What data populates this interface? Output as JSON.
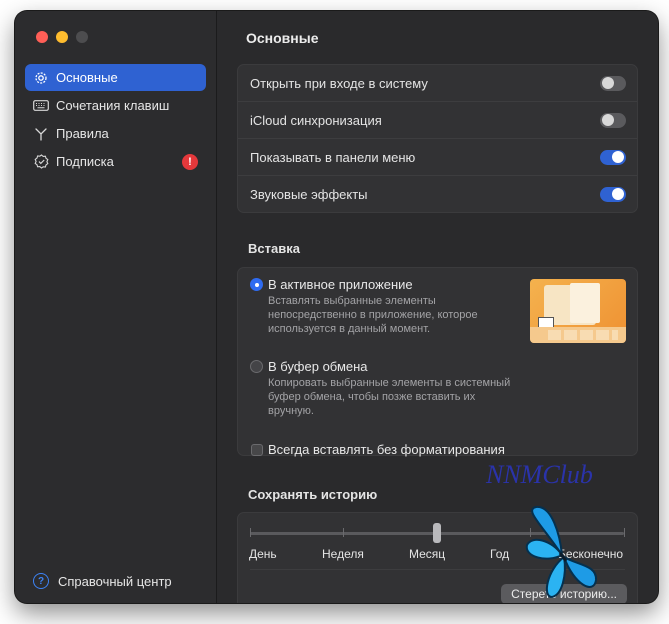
{
  "sidebar": {
    "items": [
      {
        "label": "Основные",
        "icon": "gear-icon",
        "active": true
      },
      {
        "label": "Сочетания клавиш",
        "icon": "keyboard-icon",
        "active": false
      },
      {
        "label": "Правила",
        "icon": "branch-icon",
        "active": false
      },
      {
        "label": "Подписка",
        "icon": "checkmark-seal-icon",
        "active": false,
        "badge": "!"
      }
    ],
    "help": {
      "label": "Справочный центр",
      "icon": "question-circle-icon"
    }
  },
  "main": {
    "title": "Основные",
    "general": {
      "rows": [
        {
          "label": "Открыть при входе в систему",
          "on": false
        },
        {
          "label": "iCloud синхронизация",
          "on": false
        },
        {
          "label": "Показывать в панели меню",
          "on": true
        },
        {
          "label": "Звуковые эффекты",
          "on": true
        }
      ]
    },
    "paste": {
      "title": "Вставка",
      "options": [
        {
          "label": "В активное приложение",
          "desc": "Вставлять выбранные элементы непосредственно в приложение, которое используется в данный момент.",
          "checked": true
        },
        {
          "label": "В буфер обмена",
          "desc": "Копировать выбранные элементы в системный буфер обмена,  чтобы позже вставить их вручную.",
          "checked": false
        }
      ],
      "plain_text": {
        "label": "Всегда вставлять без форматирования",
        "checked": false
      }
    },
    "history": {
      "title": "Сохранять историю",
      "levels": [
        "День",
        "Неделя",
        "Месяц",
        "Год",
        "Бесконечно"
      ],
      "selected": "Месяц",
      "clear_button": "Стереть историю..."
    }
  },
  "watermark": "NNMClub",
  "colors": {
    "accent": "#2f62d2",
    "badge": "#e5383b",
    "window_bg": "#2b2b2d"
  }
}
